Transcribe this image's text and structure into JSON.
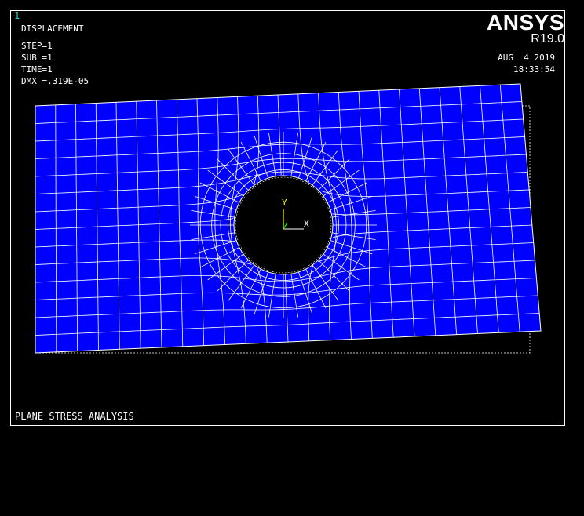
{
  "window": {
    "number": "1"
  },
  "result": {
    "title": "DISPLACEMENT",
    "step": "STEP=1",
    "sub": "SUB =1",
    "time": "TIME=1",
    "dmx": "DMX =.319E-05"
  },
  "brand": {
    "name": "ANSYS",
    "release": "R19.0"
  },
  "datetime": {
    "date": "AUG  4 2019",
    "time": "18:33:54"
  },
  "analysis": {
    "title": "PLANE STRESS ANALYSIS"
  },
  "triad": {
    "x_label": "X",
    "y_label": "Y"
  },
  "colors": {
    "background": "#000000",
    "mesh_fill": "#0000ff",
    "mesh_lines": "#ffffff",
    "triad_y": "#ffff00",
    "triad_z": "#00ff00",
    "window_number": "#19d6c8"
  }
}
